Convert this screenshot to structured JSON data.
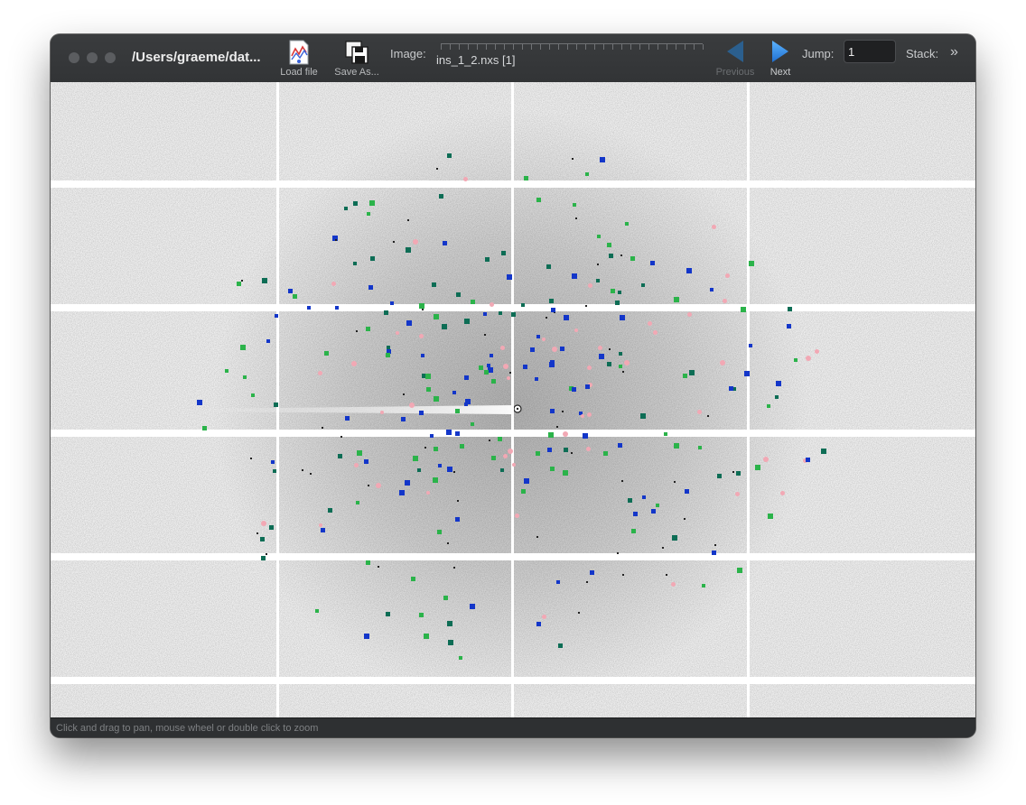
{
  "window": {
    "title": "/Users/graeme/dat..."
  },
  "toolbar": {
    "load_file_label": "Load file",
    "save_as_label": "Save As...",
    "image_label": "Image:",
    "image_name": "ins_1_2.nxs [1]",
    "previous_label": "Previous",
    "next_label": "Next",
    "jump_label": "Jump:",
    "jump_value": "1",
    "stack_label": "Stack:",
    "overflow_glyph": "»"
  },
  "status": {
    "hint": "Click and drag to pan, mouse wheel or double click to zoom"
  },
  "colors": {
    "toolbar_bg": "#333537",
    "accent_blue": "#2f8ae0",
    "spot_pink": "#f2a8b4",
    "spot_green": "#2bb34a",
    "spot_blue": "#1336c9",
    "spot_teal": "#0d6d55"
  },
  "icons": {
    "load_file": "chart-file-icon",
    "save_as": "floppy-disk-icon",
    "previous": "triangle-left-icon",
    "next": "triangle-right-icon",
    "stack_more": "double-chevron-right-icon"
  }
}
